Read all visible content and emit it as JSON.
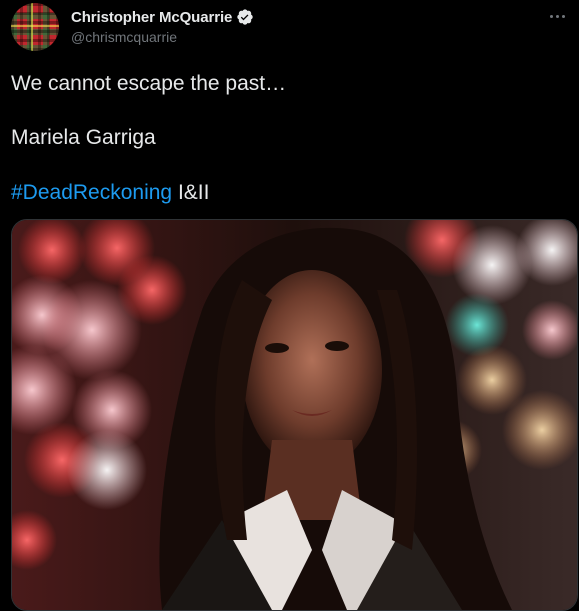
{
  "author": {
    "display_name": "Christopher McQuarrie",
    "handle": "@chrismcquarrie",
    "verified": true,
    "avatar_icon": "tartan-avatar"
  },
  "tweet": {
    "line1": "We cannot escape the past…",
    "line2": "Mariela Garriga",
    "hashtag": "#DeadReckoning",
    "line3_suffix": " I&II"
  },
  "media": {
    "type": "photo",
    "description_icon": "portrait-photo"
  },
  "colors": {
    "background": "#000000",
    "text": "#e7e9ea",
    "secondary": "#71767b",
    "link": "#1d9bf0",
    "verified": "#e7e9ea"
  }
}
